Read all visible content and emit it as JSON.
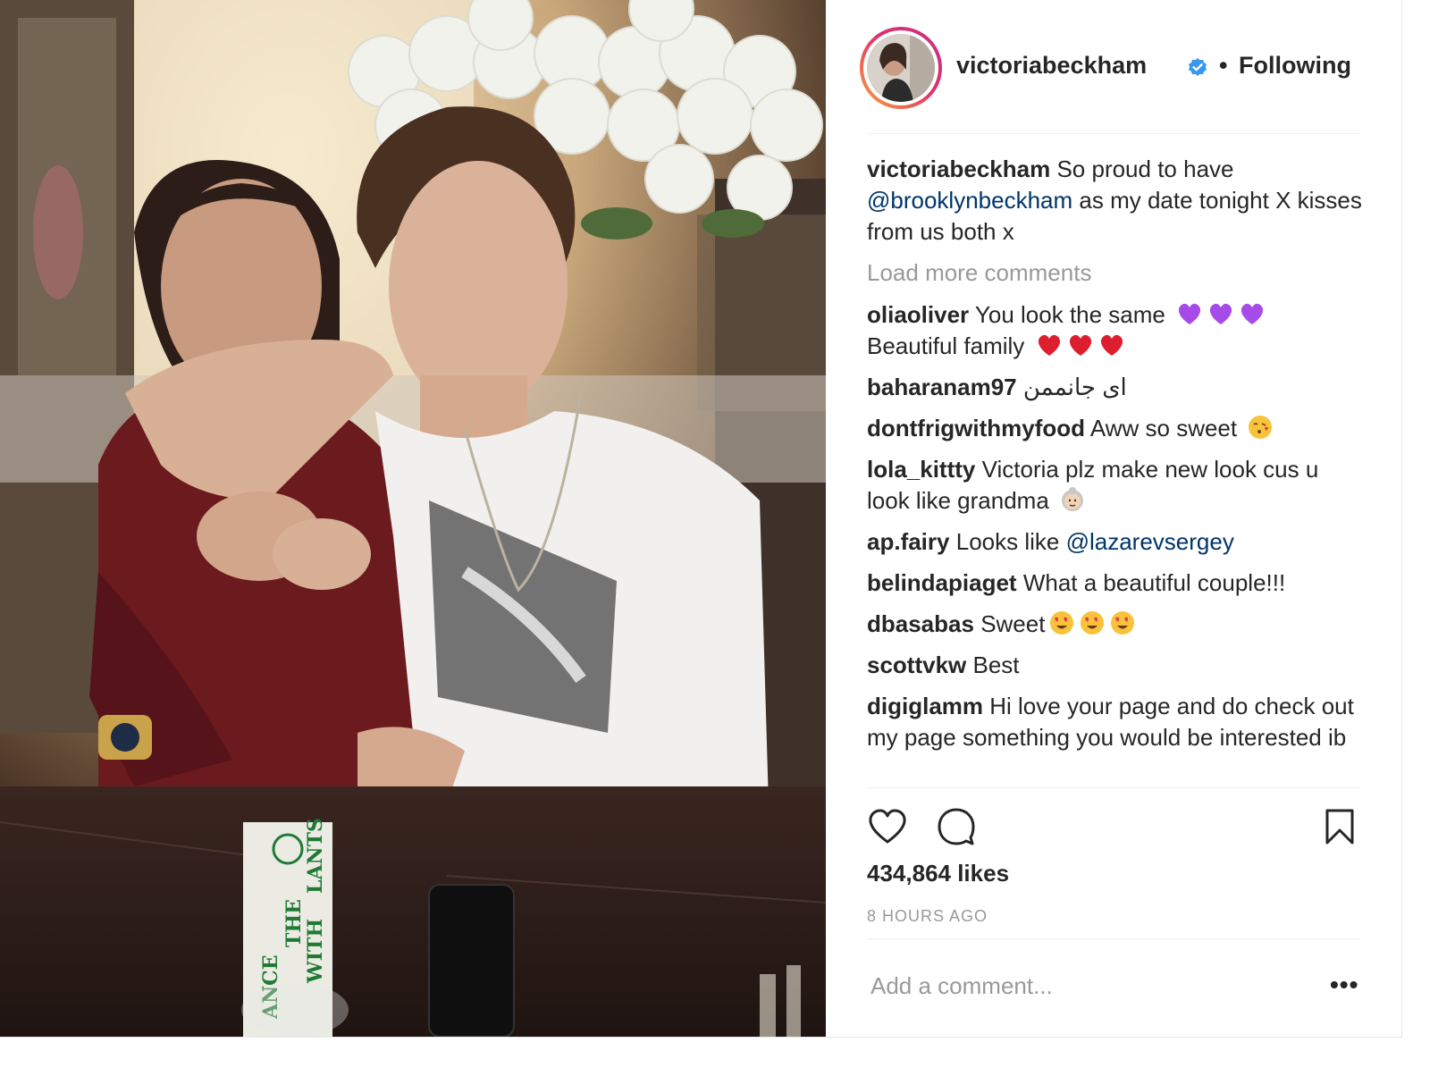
{
  "post": {
    "username": "victoriabeckham",
    "separator": "•",
    "follow_status": "Following",
    "caption": {
      "username": "victoriabeckham",
      "text_before": "So proud to have",
      "mention": "@brooklynbeckham",
      "text_after": "as my date tonight X kisses from us both x"
    },
    "load_more": "Load more comments",
    "comments": [
      {
        "username": "oliaoliver",
        "text": "You look the same",
        "emoji1": "purple-heart",
        "text2": "Beautiful family",
        "emoji2": "red-heart"
      },
      {
        "username": "baharanam97",
        "text": "ای جانممن"
      },
      {
        "username": "dontfrigwithmyfood",
        "text": "Aww so sweet",
        "emoji": "face-blowing-kiss"
      },
      {
        "username": "lola_kittty",
        "text": "Victoria plz make new look cus u look like grandma",
        "emoji": "old-woman"
      },
      {
        "username": "ap.fairy",
        "text": "Looks like",
        "mention": "@lazarevsergey"
      },
      {
        "username": "belindapiaget",
        "text": "What a beautiful couple!!!"
      },
      {
        "username": "dbasabas",
        "text": "Sweet",
        "emoji": "heart-eyes"
      },
      {
        "username": "scottvkw",
        "text": "Best"
      },
      {
        "username": "digiglamm",
        "text": "Hi love your page and do check out my page something you would be interested ib"
      }
    ],
    "likes": "434,864 likes",
    "time_ago": "8 HOURS AGO",
    "add_comment_placeholder": "Add a comment...",
    "more_options": "•••",
    "icons": {
      "like": "heart-outline-icon",
      "comment": "comment-bubble-icon",
      "save": "bookmark-icon",
      "verified": "verified-badge-icon"
    },
    "photo_text": {
      "card_left": "ANCE",
      "card_mid1": "THE",
      "card_mid2": "WITH",
      "card_right": "LANTS"
    }
  },
  "colors": {
    "text": "#262626",
    "muted": "#999999",
    "mention": "#003569",
    "verified": "#3897f0",
    "heart_red": "#dd1e2f",
    "heart_purple": "#a74be8"
  }
}
